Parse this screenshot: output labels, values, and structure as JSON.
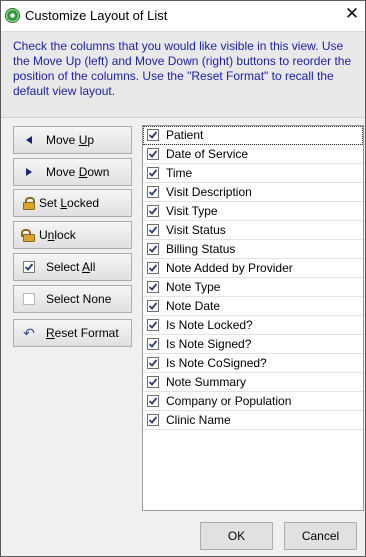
{
  "window": {
    "title": "Customize Layout of List",
    "close_glyph": "✕"
  },
  "instructions": "Check the columns that you would like visible in this view.  Use the Move Up (left) and Move Down (right) buttons to reorder the position of the columns.  Use the \"Reset Format\" to recall the default view layout.",
  "buttons": {
    "move_up": {
      "pre": "Move ",
      "accel": "U",
      "post": "p",
      "icon": "arrow-left-icon"
    },
    "move_down": {
      "pre": "Move ",
      "accel": "D",
      "post": "own",
      "icon": "arrow-right-icon"
    },
    "set_locked": {
      "pre": "Set ",
      "accel": "L",
      "post": "ocked",
      "icon": "lock-icon"
    },
    "unlock": {
      "pre": "U",
      "accel": "n",
      "post": "lock",
      "icon": "unlock-icon"
    },
    "select_all": {
      "pre": "Select ",
      "accel": "A",
      "post": "ll",
      "icon": "checked-box-icon"
    },
    "select_none": {
      "label": "Select None",
      "icon": "empty-box-icon"
    },
    "reset_format": {
      "pre": "",
      "accel": "R",
      "post": "eset Format",
      "icon": "undo-arrow-icon"
    }
  },
  "columns": [
    {
      "label": "Patient",
      "checked": true
    },
    {
      "label": "Date of Service",
      "checked": true
    },
    {
      "label": "Time",
      "checked": true
    },
    {
      "label": "Visit Description",
      "checked": true
    },
    {
      "label": "Visit Type",
      "checked": true
    },
    {
      "label": "Visit Status",
      "checked": true
    },
    {
      "label": "Billing Status",
      "checked": true
    },
    {
      "label": "Note Added by Provider",
      "checked": true
    },
    {
      "label": "Note Type",
      "checked": true
    },
    {
      "label": "Note Date",
      "checked": true
    },
    {
      "label": "Is Note Locked?",
      "checked": true
    },
    {
      "label": "Is Note Signed?",
      "checked": true
    },
    {
      "label": "Is Note CoSigned?",
      "checked": true
    },
    {
      "label": "Note Summary",
      "checked": true
    },
    {
      "label": "Company or Population",
      "checked": true
    },
    {
      "label": "Clinic Name",
      "checked": true
    }
  ],
  "dialog": {
    "ok_label": "OK",
    "cancel_label": "Cancel"
  },
  "colors": {
    "instruction_text": "#1c20b8",
    "arrow": "#1a237e"
  }
}
